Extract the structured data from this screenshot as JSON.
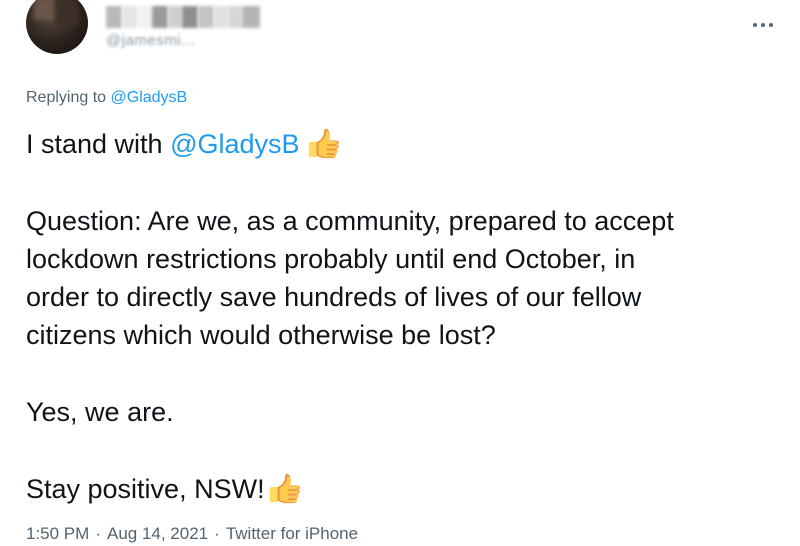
{
  "header": {
    "display_name_redacted": true,
    "handle_partial": "@jamesmi...",
    "more_icon": "more-horizontal-icon"
  },
  "reply": {
    "prefix": "Replying to",
    "target": "@GladysB"
  },
  "body": {
    "line1_text": "I stand with ",
    "line1_mention": "@GladysB",
    "question_lines": [
      "Question: Are we, as a community, prepared to accept",
      "lockdown restrictions probably until end October, in",
      "order to directly save hundreds of lives of our fellow",
      "citizens which would otherwise be lost?"
    ],
    "answer": "Yes, we are.",
    "closing": "Stay positive, NSW!",
    "emoji_icon": "thumbs-up-icon"
  },
  "meta": {
    "time": "1:50 PM",
    "date": "Aug 14, 2021",
    "source": "Twitter for iPhone",
    "separator": "·"
  },
  "colors": {
    "link": "#1d9bf0",
    "text": "#0f1419",
    "muted": "#536471"
  }
}
